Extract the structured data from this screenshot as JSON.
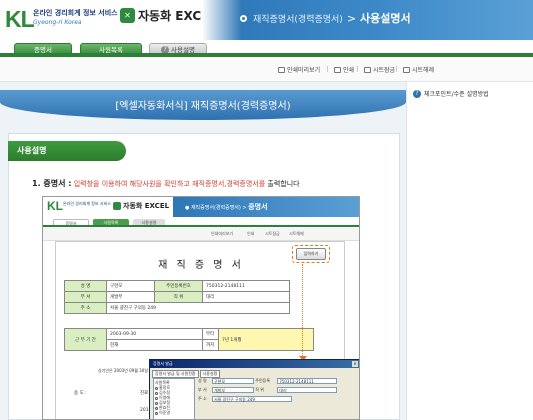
{
  "header": {
    "logo_mark": "KL",
    "logo_korean": "온라인 경리회계 정보 서비스",
    "logo_english": "Gyeong-ri Korea",
    "product_icon": "excel-icon",
    "product_name": "자동화 EXCEL",
    "breadcrumb_parent": "재직증명서(경력증명서)",
    "breadcrumb_separator": ">",
    "breadcrumb_current": "사용설명서",
    "colors": {
      "header_blue": "#2e77b7",
      "green": "#2d7f3a"
    }
  },
  "tabs": [
    {
      "label": "증명서"
    },
    {
      "label": "사원목록"
    },
    {
      "label": "사용설명"
    }
  ],
  "toolbar": {
    "items": [
      {
        "label": "인쇄미리보기",
        "icon": "print-preview-icon"
      },
      {
        "label": "인쇄",
        "icon": "print-icon"
      },
      {
        "label": "시트잠금",
        "icon": "sheet-lock-icon"
      },
      {
        "label": "시트해제",
        "icon": "sheet-unlock-icon"
      }
    ]
  },
  "main": {
    "ribbon_title": "[엑셀자동화서식] 재직증명서(경력증명서)",
    "section_header": "사용설명",
    "step": {
      "number": "1. 증명서 :",
      "text_red": "입력창을 이용하여 해당사원을 확인하고 재직증명서,경력증명서를",
      "text_black": "출력합니다"
    }
  },
  "embedded": {
    "logo_mark": "KL",
    "logo_text": "온라인 경리회계 정보 서비스",
    "product_name": "자동화 EXCEL",
    "breadcrumb_parent": "재직증명서(경력증명서)",
    "breadcrumb_current": "증명서",
    "tabs": [
      "증명서",
      "사원목록",
      "사용설명"
    ],
    "toolbar": [
      "인쇄미리보기",
      "인쇄",
      "시트잠금",
      "시트해제"
    ],
    "doc_title": "재 직 증 명 서",
    "input_button": "입력하기",
    "rows": [
      {
        "label1": "성 명",
        "value1": "구현모",
        "label2": "주민등록번호",
        "value2": "750312-2148111"
      },
      {
        "label1": "부 서",
        "value1": "개발부",
        "label2": "직 위",
        "value2": "대리"
      },
      {
        "label1": "주 소",
        "value1": "서울 광진구 구의동 249"
      }
    ],
    "period_label": "근 무 기 간",
    "period_start": "2003-09-30",
    "period_start_tag": "부터",
    "period_end": "현재",
    "period_end_tag": "까지",
    "period_total": "7년 1개월",
    "note": "상기인은 2003년 09월 30일 부터",
    "purpose_label": "용 도 :",
    "purpose_value": "진료",
    "year_fragment": "201"
  },
  "dialog": {
    "title": "증명서 발급",
    "tabs": [
      "증명서 발급 및 사원전환",
      "사용설명"
    ],
    "list_header": "사원목록",
    "employees": [
      "홍정로",
      "김수정",
      "이영애",
      "김보정",
      "한효진",
      "이준영"
    ],
    "fields": [
      {
        "k": "성 명",
        "v": "구현모",
        "k2": "주민등록",
        "v2": "750312-2148111"
      },
      {
        "k": "부 서",
        "v": "개발부",
        "k2": "직 위",
        "v2": "대리"
      },
      {
        "k": "주 소",
        "v": "서울 광진구 구의동 249",
        "k2": "",
        "v2": ""
      }
    ]
  },
  "sidebar": {
    "help_link": "체크포인트/수준 설명방법"
  }
}
